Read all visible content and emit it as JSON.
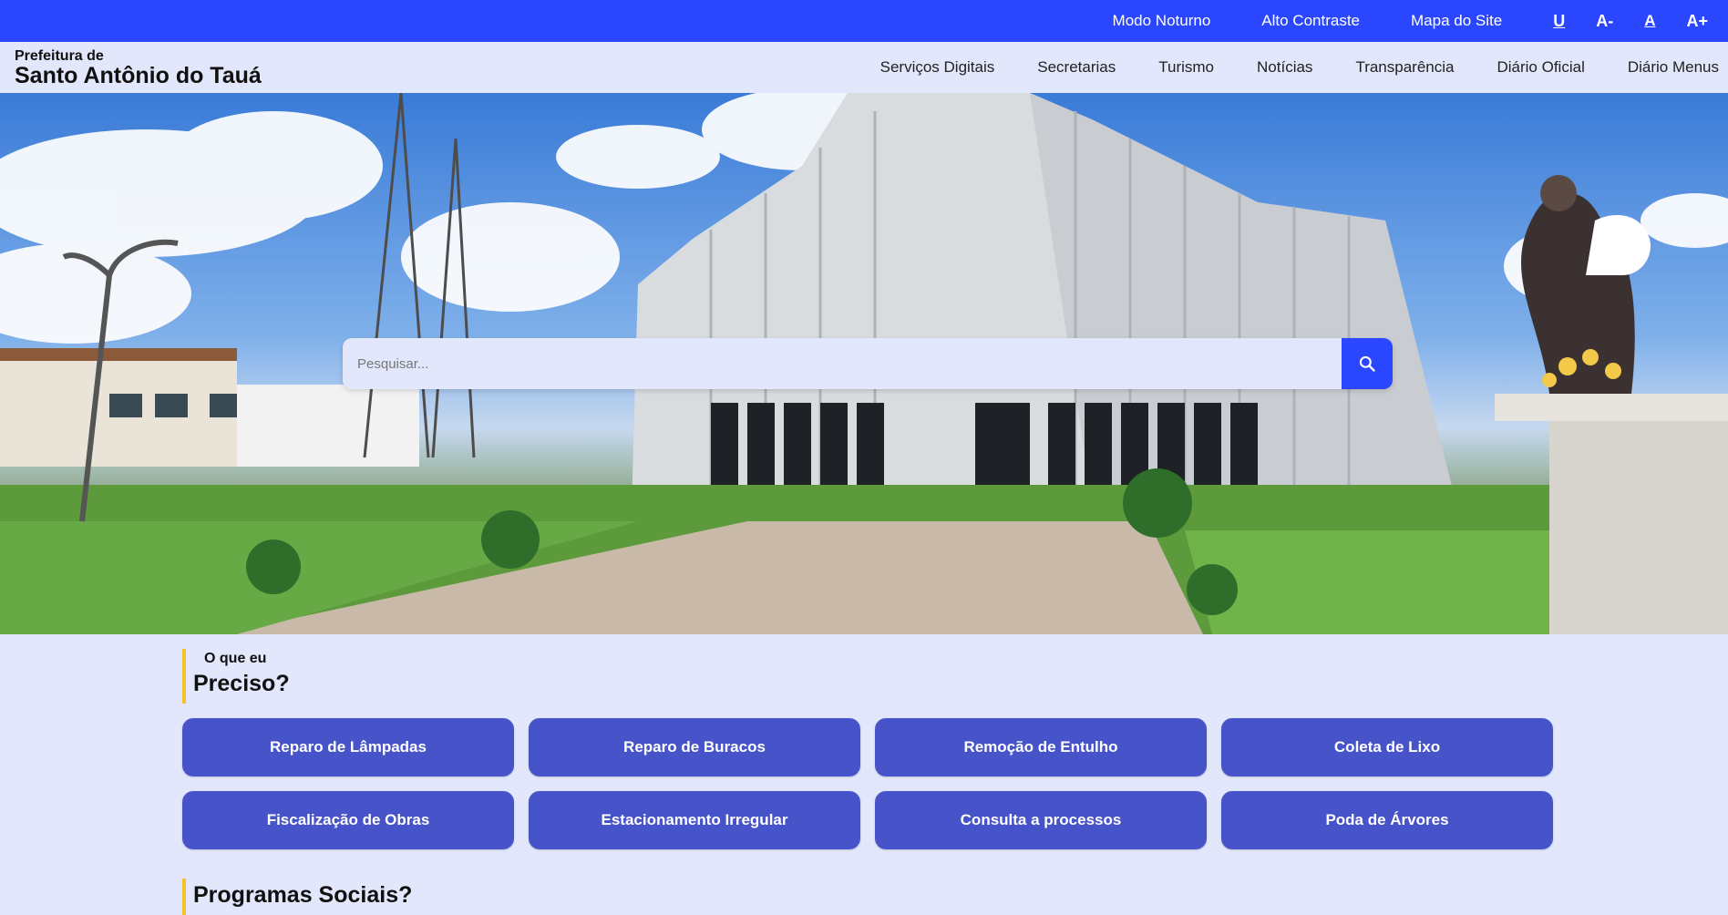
{
  "topbar": {
    "links": [
      "Modo Noturno",
      "Alto Contraste",
      "Mapa do Site"
    ],
    "a11y": [
      "U",
      "A-",
      "A",
      "A+"
    ]
  },
  "brand": {
    "small": "Prefeitura de",
    "name": "Santo Antônio do Tauá"
  },
  "nav": {
    "items": [
      "Serviços Digitais",
      "Secretarias",
      "Turismo",
      "Notícias",
      "Transparência",
      "Diário Oficial",
      "Diário Menus"
    ]
  },
  "search": {
    "placeholder": "Pesquisar...",
    "value": ""
  },
  "section1": {
    "pre": "O que eu",
    "title": "Preciso?"
  },
  "services": [
    "Reparo de Lâmpadas",
    "Reparo de Buracos",
    "Remoção de Entulho",
    "Coleta de Lixo",
    "Fiscalização de Obras",
    "Estacionamento Irregular",
    "Consulta a processos",
    "Poda de Árvores"
  ],
  "section2": {
    "title": "Programas Sociais?"
  },
  "colors": {
    "accent": "#2b46ff",
    "card": "#4754c9",
    "background": "#e3e7fb",
    "highlight": "#f4c22b"
  }
}
